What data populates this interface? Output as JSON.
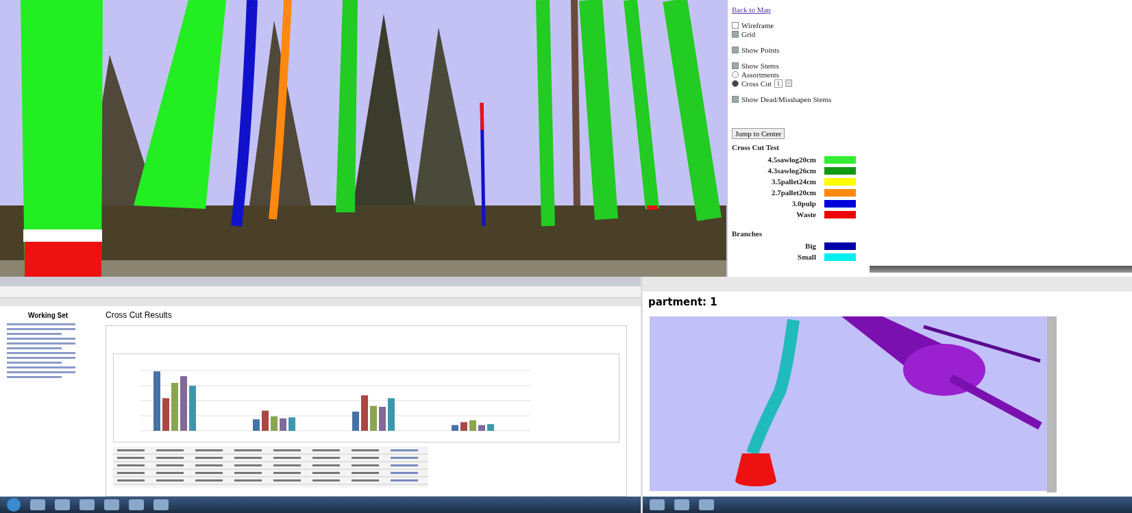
{
  "viewer": {
    "back_link": "Back to Map",
    "option_groups": [
      [
        {
          "kind": "checkbox",
          "label": "Wireframe",
          "checked": false
        },
        {
          "kind": "checkbox",
          "label": "Grid",
          "checked": true
        }
      ],
      [
        {
          "kind": "checkbox",
          "label": "Show Points",
          "checked": true
        }
      ],
      [
        {
          "kind": "checkbox",
          "label": "Show Stems",
          "checked": true
        },
        {
          "kind": "radio",
          "label": "Assortments",
          "selected": false
        },
        {
          "kind": "radio",
          "label": "Cross Cut",
          "selected": true,
          "select_value": "1"
        }
      ],
      [
        {
          "kind": "checkbox",
          "label": "Show Dead/Misshapen Stems",
          "checked": true
        }
      ]
    ],
    "center_button": "Jump to Center",
    "legend_title": "Cross Cut Test",
    "legend": [
      {
        "label": "4.5sawlog20cm",
        "color": "#33ee33"
      },
      {
        "label": "4.3sawlog26cm",
        "color": "#119911"
      },
      {
        "label": "3.5pallet24cm",
        "color": "#ffff00"
      },
      {
        "label": "2.7pallet20cm",
        "color": "#ff8811"
      },
      {
        "label": "3.0pulp",
        "color": "#0000dd"
      },
      {
        "label": "Waste",
        "color": "#ee0000"
      }
    ],
    "branches_title": "Branches",
    "branches": [
      {
        "label": "Big",
        "color": "#0000aa"
      },
      {
        "label": "Small",
        "color": "#00eeee"
      }
    ]
  },
  "left_window": {
    "sidebar_title": "Working Set",
    "page_title": "Cross Cut Results"
  },
  "right_window": {
    "heading": "partment: 1"
  }
}
